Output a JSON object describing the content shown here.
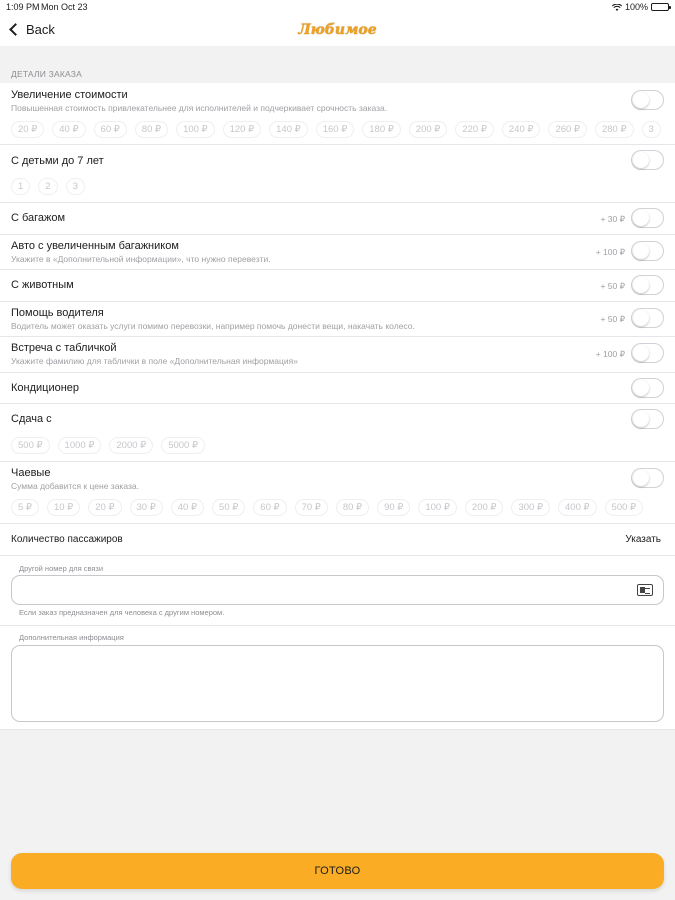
{
  "status": {
    "time": "1:09 PM",
    "date": "Mon Oct 23",
    "battery": "100%",
    "battery_level": 1.0
  },
  "nav": {
    "back_label": "Back",
    "title": "Любимое"
  },
  "section": {
    "header": "ДЕТАЛИ ЗАКАЗА"
  },
  "price_increase": {
    "title": "Увеличение стоимости",
    "subtitle": "Повышенная стоимость привлекательнее для исполнителей и подчеркивает срочность заказа.",
    "toggle_on": false,
    "chips": [
      "20 ₽",
      "40 ₽",
      "60 ₽",
      "80 ₽",
      "100 ₽",
      "120 ₽",
      "140 ₽",
      "160 ₽",
      "180 ₽",
      "200 ₽",
      "220 ₽",
      "240 ₽",
      "260 ₽",
      "280 ₽",
      "3"
    ]
  },
  "children": {
    "title": "С детьми до 7 лет",
    "toggle_on": false,
    "chips": [
      "1",
      "2",
      "3"
    ]
  },
  "luggage": {
    "title": "С багажом",
    "price": "+ 30 ₽",
    "toggle_on": false
  },
  "big_trunk": {
    "title": "Авто с увеличенным багажником",
    "subtitle": "Укажите в «Дополнительной информации», что нужно перевезти.",
    "price": "+ 100 ₽",
    "toggle_on": false
  },
  "animal": {
    "title": "С животным",
    "price": "+ 50 ₽",
    "toggle_on": false
  },
  "driver_help": {
    "title": "Помощь водителя",
    "subtitle": "Водитель может оказать услуги помимо перевозки, например помочь донести вещи, накачать колесо.",
    "price": "+ 50 ₽",
    "toggle_on": false
  },
  "meeting": {
    "title": "Встреча с табличкой",
    "subtitle": "Укажите фамилию для таблички в поле «Дополнительная информация»",
    "price": "+ 100 ₽",
    "toggle_on": false
  },
  "ac": {
    "title": "Кондиционер",
    "toggle_on": false
  },
  "change": {
    "title": "Сдача с",
    "toggle_on": false,
    "chips": [
      "500 ₽",
      "1000 ₽",
      "2000 ₽",
      "5000 ₽"
    ]
  },
  "tips": {
    "title": "Чаевые",
    "subtitle": "Сумма добавится к цене заказа.",
    "toggle_on": false,
    "chips": [
      "5 ₽",
      "10 ₽",
      "20 ₽",
      "30 ₽",
      "40 ₽",
      "50 ₽",
      "60 ₽",
      "70 ₽",
      "80 ₽",
      "90 ₽",
      "100 ₽",
      "200 ₽",
      "300 ₽",
      "400 ₽",
      "500 ₽"
    ]
  },
  "passengers": {
    "title": "Количество пассажиров",
    "action": "Указать"
  },
  "contact": {
    "label": "Другой номер для связи",
    "value": "",
    "placeholder": "",
    "hint": "Если заказ предназначен для человека с другим номером."
  },
  "extra": {
    "label": "Дополнительная информация",
    "value": "",
    "placeholder": ""
  },
  "done": {
    "label": "ГОТОВО"
  },
  "colors": {
    "accent": "#f9ac24",
    "title": "#f0a11c"
  }
}
